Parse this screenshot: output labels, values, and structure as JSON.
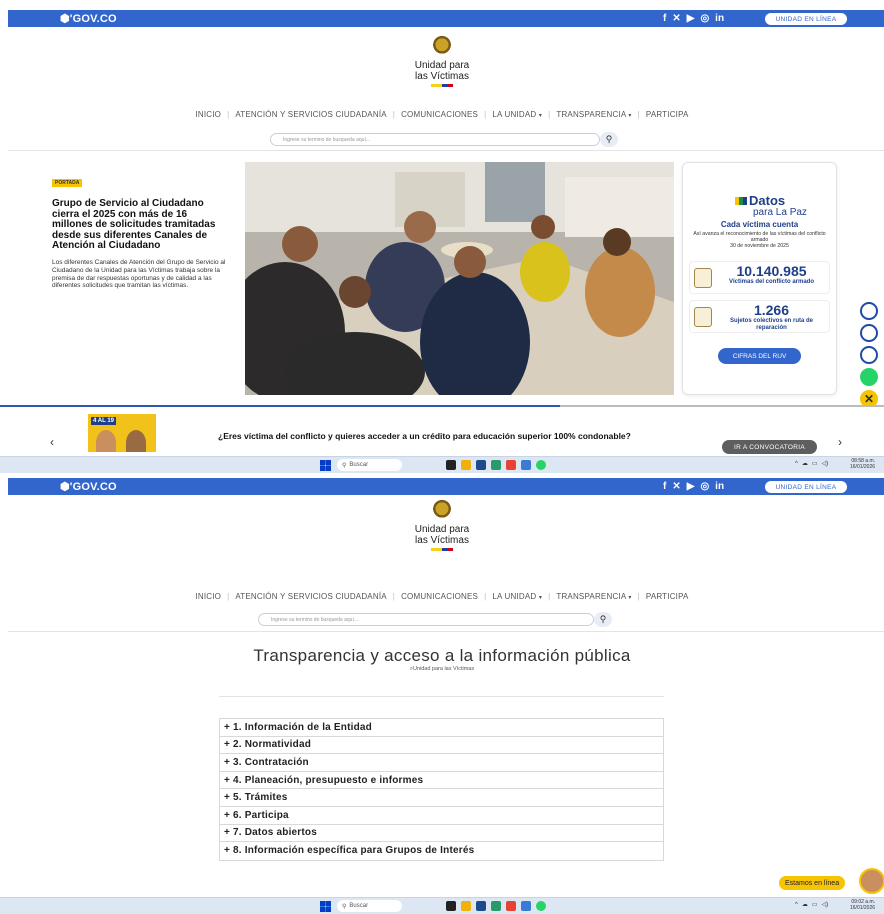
{
  "gov": {
    "logo": "&#x2741;GOV.CO",
    "social": [
      "f",
      "✕",
      "▶",
      "◎",
      "in"
    ],
    "unidad_btn": "UNIDAD EN LÍNEA"
  },
  "brand": {
    "line1": "Unidad para",
    "line2": "las Víctimas"
  },
  "menu": {
    "items": [
      "INICIO",
      "ATENCIÓN Y SERVICIOS CIUDADANÍA",
      "COMUNICACIONES",
      "LA UNIDAD",
      "TRANSPARENCIA",
      "PARTICIPA"
    ],
    "caret": "▾"
  },
  "search": {
    "placeholder": "Ingrese su termino de busqueda aquí...",
    "icon": "search-icon"
  },
  "news": {
    "badge": "PORTADA",
    "headline": "Grupo de Servicio al Ciudadano cierra el 2025 con más de 16 millones de solicitudes tramitadas desde sus diferentes Canales de Atención al Ciudadano",
    "summary": "Los diferentes Canales de Atención del Grupo de Servicio al Ciudadano de la Unidad para las Víctimas trabaja sobre la premisa de dar respuestas oportunas y de calidad a las diferentes solicitudes que tramitan las víctimas."
  },
  "datos": {
    "logo": "Datos",
    "logo_sub": "para La Paz",
    "title": "Cada víctima cuenta",
    "desc": "Así avanza el reconocimiento de las víctimas del conflicto armado",
    "date": "30 de noviembre de 2025",
    "stat1_num": "10.140.985",
    "stat1_label": "Víctimas del conflicto armado",
    "stat2_num": "1.266",
    "stat2_label": "Sujetos colectivos en ruta de reparación",
    "button": "CIFRAS DEL RUV"
  },
  "carousel": {
    "tag": "4 AL 19",
    "text": "¿Eres víctima del conflicto y quieres acceder a un crédito para educación superior 100% condonable?",
    "button": "IR A CONVOCATORIA",
    "prev": "‹",
    "next": "›"
  },
  "taskbar": {
    "search": "Buscar",
    "clock1": "08:58 a.m.",
    "date1": "16/01/2026",
    "clock2": "09:02 a.m.",
    "date2": "16/01/2026"
  },
  "transparencia": {
    "title": "Transparencia y acceso a la información pública",
    "subtitle": "Unidad para las Víctimas",
    "items": [
      "+ 1. Información de la Entidad",
      "+ 2. Normatividad",
      "+ 3. Contratación",
      "+ 4. Planeación, presupuesto e informes",
      "+ 5. Trámites",
      "+ 6. Participa",
      "+ 7. Datos abiertos",
      "+ 8. Información específica para Grupos de Interés"
    ]
  },
  "chat": {
    "label": "Estamos en línea"
  },
  "colors": {
    "gov_blue": "#3366cc",
    "accent_yellow": "#f7c400",
    "datos_blue": "#1f3f8a"
  }
}
